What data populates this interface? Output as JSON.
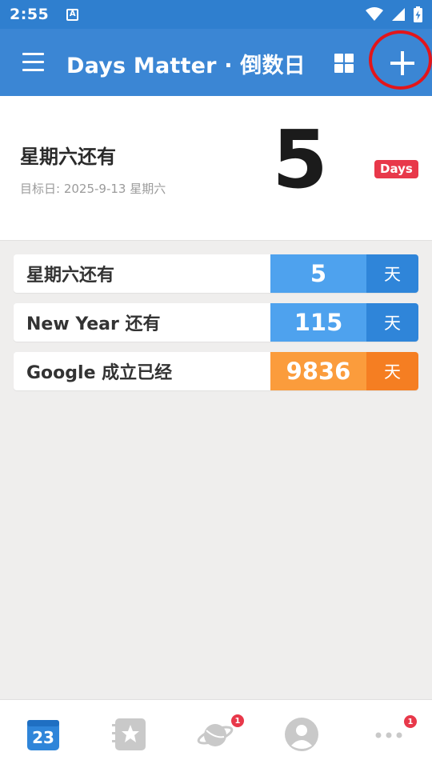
{
  "status_bar": {
    "time": "2:55",
    "notification_letter": "A"
  },
  "app_bar": {
    "title": "Days Matter · 倒数日"
  },
  "hero": {
    "title": "星期六还有",
    "subtitle": "目标日: 2025-9-13 星期六",
    "count": "5",
    "badge": "Days"
  },
  "events": [
    {
      "title": "星期六还有",
      "count": "5",
      "unit": "天",
      "count_color": "#4ea2ee",
      "unit_color": "#2f85d9"
    },
    {
      "title": "New Year 还有",
      "count": "115",
      "unit": "天",
      "count_color": "#4ea2ee",
      "unit_color": "#2f85d9"
    },
    {
      "title": "Google 成立已经",
      "count": "9836",
      "unit": "天",
      "count_color": "#fb9c3c",
      "unit_color": "#f57e22"
    }
  ],
  "bottom_nav": {
    "calendar_day": "23",
    "discover_badge": "1",
    "more_badge": "1"
  },
  "colors": {
    "status_bar": "#2f7fcf",
    "app_bar": "#3b86d4",
    "highlight_circle": "#e3151a",
    "badge_red": "#e8384a"
  },
  "icons": [
    "menu-icon",
    "grid-view-icon",
    "add-icon",
    "wifi-icon",
    "signal-icon",
    "battery-icon",
    "calendar-icon",
    "star-list-icon",
    "planet-icon",
    "avatar-icon",
    "more-icon"
  ]
}
